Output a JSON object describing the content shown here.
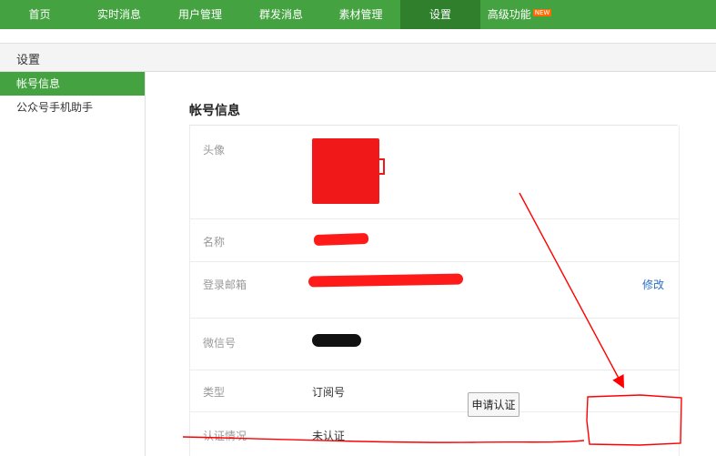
{
  "nav": {
    "items": [
      {
        "label": "首页"
      },
      {
        "label": "实时消息"
      },
      {
        "label": "用户管理"
      },
      {
        "label": "群发消息"
      },
      {
        "label": "素材管理"
      },
      {
        "label": "设置",
        "active": true
      },
      {
        "label": "高级功能",
        "badge": "NEW"
      }
    ]
  },
  "page": {
    "title": "设置"
  },
  "sidebar": {
    "items": [
      {
        "label": "帐号信息",
        "active": true
      },
      {
        "label": "公众号手机助手"
      }
    ]
  },
  "account": {
    "heading": "帐号信息",
    "avatar_label": "头像",
    "name_label": "名称",
    "email_label": "登录邮箱",
    "email_edit": "修改",
    "wechat_label": "微信号",
    "type_label": "类型",
    "type_value": "订阅号",
    "verify_label": "认证情况",
    "verify_value": "未认证",
    "verify_button": "申请认证"
  },
  "colors": {
    "nav_bg": "#44a340",
    "nav_active": "#2f7f2c",
    "link": "#2a6fc9",
    "annotation": "#ff0000"
  }
}
